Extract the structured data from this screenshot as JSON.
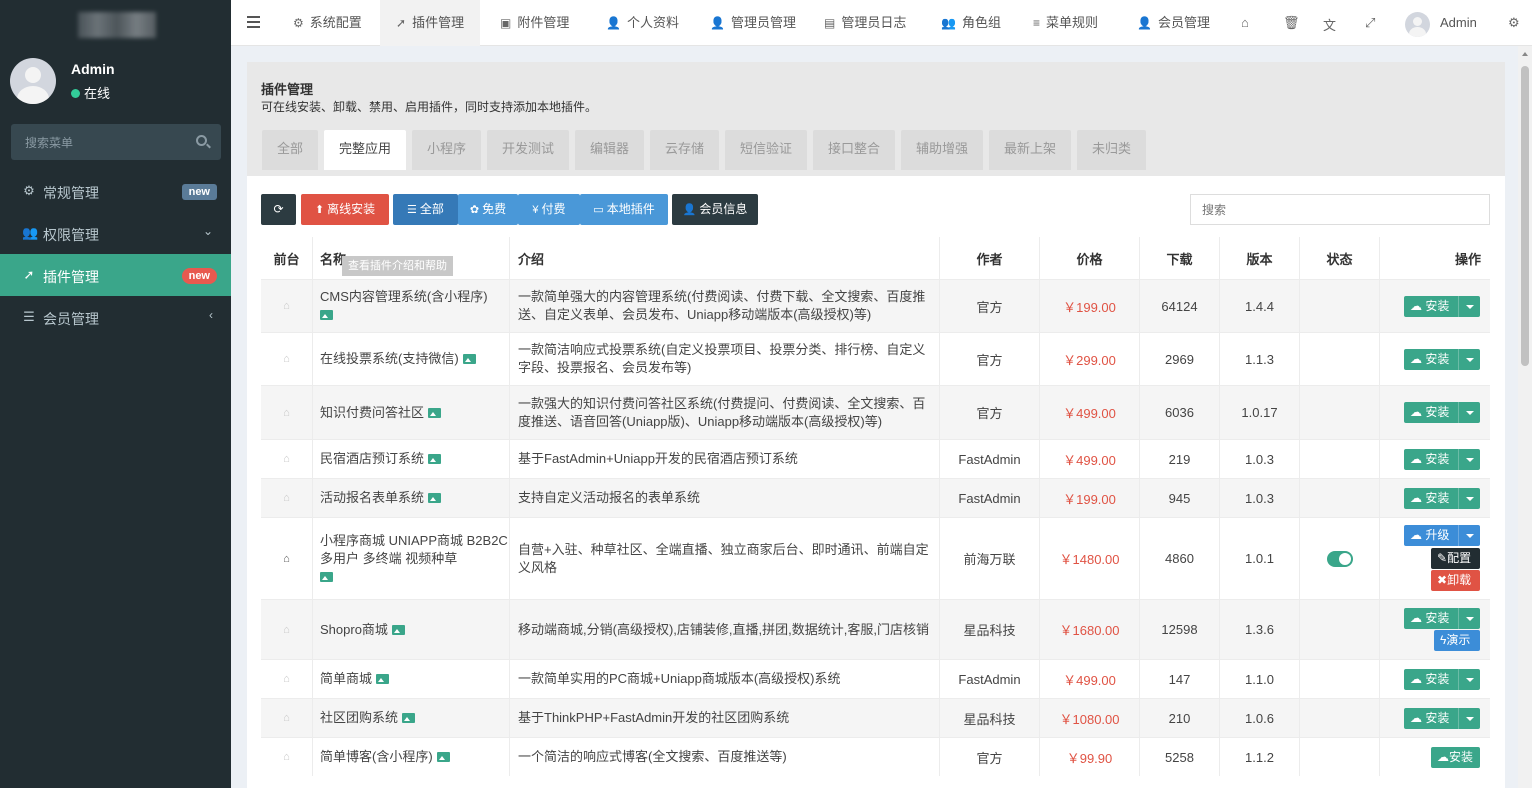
{
  "sidebar": {
    "user": {
      "name": "Admin",
      "status": "在线"
    },
    "search_placeholder": "搜索菜单",
    "items": [
      {
        "label": "常规管理",
        "badge": "new",
        "icon": "cogs-icon"
      },
      {
        "label": "权限管理",
        "icon": "users-icon"
      },
      {
        "label": "插件管理",
        "badge": "new",
        "icon": "rocket-icon",
        "active": true
      },
      {
        "label": "会员管理",
        "icon": "list-icon"
      }
    ]
  },
  "topbar": {
    "tabs": [
      "系统配置",
      "插件管理",
      "附件管理",
      "个人资料",
      "管理员管理",
      "管理员日志",
      "角色组",
      "菜单规则",
      "会员管理"
    ],
    "active_tab": "插件管理",
    "user": "Admin"
  },
  "panel": {
    "title": "插件管理",
    "description": "可在线安装、卸载、禁用、启用插件，同时支持添加本地插件。",
    "category_tabs": [
      "全部",
      "完整应用",
      "小程序",
      "开发测试",
      "编辑器",
      "云存储",
      "短信验证",
      "接口整合",
      "辅助增强",
      "最新上架",
      "未归类"
    ],
    "active_category": "完整应用"
  },
  "toolbar": {
    "offline_install": "离线安装",
    "filter_all": "全部",
    "filter_free": "免费",
    "filter_paid": "付费",
    "filter_local": "本地插件",
    "member_info": "会员信息",
    "search_placeholder": "搜索"
  },
  "table": {
    "headers": {
      "front": "前台",
      "name": "名称",
      "intro": "介绍",
      "author": "作者",
      "price": "价格",
      "downloads": "下载",
      "version": "版本",
      "status": "状态",
      "actions": "操作"
    },
    "tooltip": "查看插件介绍和帮助",
    "rows": [
      {
        "name": "CMS内容管理系统(含小程序)",
        "intro": "一款简单强大的内容管理系统(付费阅读、付费下载、全文搜索、百度推送、自定义表单、会员发布、Uniapp移动端版本(高级授权)等)",
        "author": "官方",
        "price": "￥199.00",
        "downloads": "64124",
        "version": "1.4.4",
        "action": "安装"
      },
      {
        "name": "在线投票系统(支持微信)",
        "intro": "一款简洁响应式投票系统(自定义投票项目、投票分类、排行榜、自定义字段、投票报名、会员发布等)",
        "author": "官方",
        "price": "￥299.00",
        "downloads": "2969",
        "version": "1.1.3",
        "action": "安装"
      },
      {
        "name": "知识付费问答社区",
        "intro": "一款强大的知识付费问答社区系统(付费提问、付费阅读、全文搜索、百度推送、语音回答(Uniapp版)、Uniapp移动端版本(高级授权)等)",
        "author": "官方",
        "price": "￥499.00",
        "downloads": "6036",
        "version": "1.0.17",
        "action": "安装"
      },
      {
        "name": "民宿酒店预订系统",
        "intro": "基于FastAdmin+Uniapp开发的民宿酒店预订系统",
        "author": "FastAdmin",
        "price": "￥499.00",
        "downloads": "219",
        "version": "1.0.3",
        "action": "安装"
      },
      {
        "name": "活动报名表单系统",
        "intro": "支持自定义活动报名的表单系统",
        "author": "FastAdmin",
        "price": "￥199.00",
        "downloads": "945",
        "version": "1.0.3",
        "action": "安装"
      },
      {
        "name": "小程序商城 UNIAPP商城 B2B2C多用户 多终端 视频种草",
        "intro": "自营+入驻、种草社区、全端直播、独立商家后台、即时通讯、前端自定义风格",
        "author": "前海万联",
        "price": "￥1480.00",
        "downloads": "4860",
        "version": "1.0.1",
        "action": "升级",
        "action2": "配置",
        "action3": "卸载"
      },
      {
        "name": "Shopro商城",
        "intro": "移动端商城,分销(高级授权),店铺装修,直播,拼团,数据统计,客服,门店核销",
        "author": "星品科技",
        "price": "￥1680.00",
        "downloads": "12598",
        "version": "1.3.6",
        "action": "安装",
        "action2": "演示"
      },
      {
        "name": "简单商城",
        "intro": "一款简单实用的PC商城+Uniapp商城版本(高级授权)系统",
        "author": "FastAdmin",
        "price": "￥499.00",
        "downloads": "147",
        "version": "1.1.0",
        "action": "安装"
      },
      {
        "name": "社区团购系统",
        "intro": "基于ThinkPHP+FastAdmin开发的社区团购系统",
        "author": "星品科技",
        "price": "￥1080.00",
        "downloads": "210",
        "version": "1.0.6",
        "action": "安装"
      },
      {
        "name": "简单博客(含小程序)",
        "intro": "一个简洁的响应式博客(全文搜索、百度推送等)",
        "author": "官方",
        "price": "￥99.90",
        "downloads": "5258",
        "version": "1.1.2",
        "action": "安装"
      }
    ]
  }
}
